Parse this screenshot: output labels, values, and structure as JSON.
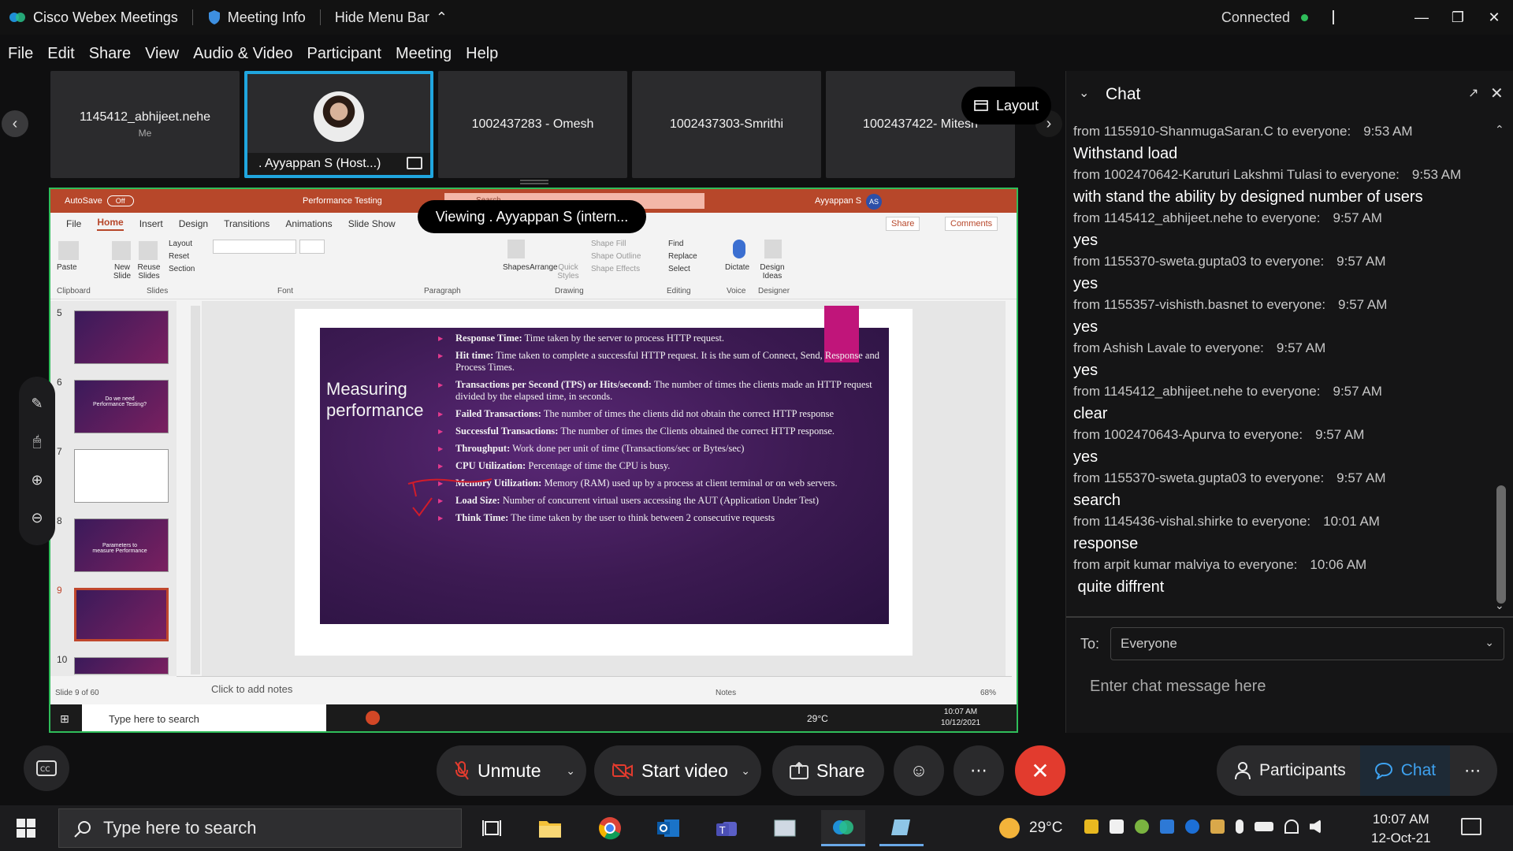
{
  "window": {
    "app_title": "Cisco Webex Meetings",
    "meeting_info_label": "Meeting Info",
    "hide_menu_label": "Hide Menu Bar",
    "status": "Connected",
    "status_color": "#2fbd5a"
  },
  "menu": [
    "File",
    "Edit",
    "Share",
    "View",
    "Audio & Video",
    "Participant",
    "Meeting",
    "Help"
  ],
  "participants": [
    {
      "name": "1145412_abhijeet.nehe",
      "sub": "Me"
    },
    {
      "name": ". Ayyappan S (Host...)",
      "sub": ""
    },
    {
      "name": "1002437283 - Omesh",
      "sub": ""
    },
    {
      "name": "1002437303-Smrithi",
      "sub": ""
    },
    {
      "name": "1002437422- Mitesh",
      "sub": ""
    }
  ],
  "layout_label": "Layout",
  "viewing_label": "Viewing . Ayyappan S (intern...",
  "ppt": {
    "autosave": "AutoSave",
    "autosave_state": "Off",
    "doc_name": "Performance Testing",
    "search": "Search",
    "user": "Ayyappan S",
    "user_initials": "AS",
    "tabs": [
      "File",
      "Home",
      "Insert",
      "Design",
      "Transitions",
      "Animations",
      "Slide Show"
    ],
    "share": "Share",
    "comments": "Comments",
    "groups": [
      "Clipboard",
      "Slides",
      "Font",
      "Paragraph",
      "Drawing",
      "Editing",
      "Voice",
      "Designer"
    ],
    "ribbon_buttons": {
      "paste": "Paste",
      "new_slide": "New Slide",
      "reuse_slides": "Reuse Slides",
      "layout": "Layout",
      "reset": "Reset",
      "section": "Section",
      "shapes": "Shapes",
      "arrange": "Arrange",
      "quick_styles": "Quick Styles",
      "shape_fill": "Shape Fill",
      "shape_outline": "Shape Outline",
      "shape_effects": "Shape Effects",
      "find": "Find",
      "replace": "Replace",
      "select": "Select",
      "dictate": "Dictate",
      "design_ideas": "Design Ideas"
    },
    "thumbnails": [
      {
        "num": "5",
        "text": ""
      },
      {
        "num": "6",
        "text": "Do we need Performance Testing?"
      },
      {
        "num": "7",
        "text": ""
      },
      {
        "num": "8",
        "text": "Parameters to measure Performance"
      },
      {
        "num": "9",
        "text": ""
      },
      {
        "num": "10",
        "text": ""
      }
    ],
    "slide_title": "Measuring performance",
    "bullets": [
      {
        "term": "Response Time:",
        "desc": " Time taken by the server to process HTTP request."
      },
      {
        "term": "Hit time:",
        "desc": " Time taken to complete a successful HTTP request. It is the sum of Connect, Send, Response and Process Times."
      },
      {
        "term": "Transactions per Second (TPS) or Hits/second:",
        "desc": " The number of times the clients made an HTTP request divided by the elapsed time, in seconds."
      },
      {
        "term": "Failed Transactions:",
        "desc": " The number of times the clients did not obtain the correct HTTP response"
      },
      {
        "term": "Successful Transactions:",
        "desc": " The number of times the Clients obtained the correct HTTP response."
      },
      {
        "term": "Throughput:",
        "desc": " Work done per unit of time (Transactions/sec or Bytes/sec)"
      },
      {
        "term": "CPU Utilization:",
        "desc": " Percentage of time the CPU is busy."
      },
      {
        "term": "Memory Utilization:",
        "desc": " Memory (RAM) used up by a process at client terminal or on web servers."
      },
      {
        "term": "Load Size:",
        "desc": " Number of concurrent virtual users accessing the AUT (Application Under Test)"
      },
      {
        "term": "Think Time:",
        "desc": " The time taken by the user to think between 2 consecutive requests"
      }
    ],
    "notes_placeholder": "Click to add notes",
    "slide_count": "Slide 9 of 60",
    "notes_label": "Notes",
    "zoom": "68%",
    "taskbar_search": "Type here to search",
    "temp": "29°C",
    "clock_time": "10:07 AM",
    "clock_date": "10/12/2021"
  },
  "chat": {
    "title": "Chat",
    "messages": [
      {
        "meta": "from 1155910-ShanmugaSaran.C to everyone:",
        "time": "9:53 AM",
        "text": "Withstand load"
      },
      {
        "meta": "from 1002470642-Karuturi Lakshmi Tulasi to everyone:",
        "time": "9:53 AM",
        "text": "with stand the ability by designed number of users"
      },
      {
        "meta": "from 1145412_abhijeet.nehe to everyone:",
        "time": "9:57 AM",
        "text": "yes"
      },
      {
        "meta": "from 1155370-sweta.gupta03 to everyone:",
        "time": "9:57 AM",
        "text": "yes"
      },
      {
        "meta": "from 1155357-vishisth.basnet to everyone:",
        "time": "9:57 AM",
        "text": "yes"
      },
      {
        "meta": "from Ashish Lavale to everyone:",
        "time": "9:57 AM",
        "text": "yes"
      },
      {
        "meta": "from 1145412_abhijeet.nehe to everyone:",
        "time": "9:57 AM",
        "text": "clear"
      },
      {
        "meta": "from 1002470643-Apurva to everyone:",
        "time": "9:57 AM",
        "text": "yes"
      },
      {
        "meta": "from 1155370-sweta.gupta03 to everyone:",
        "time": "9:57 AM",
        "text": "search"
      },
      {
        "meta": "from 1145436-vishal.shirke to everyone:",
        "time": "10:01 AM",
        "text": "response"
      },
      {
        "meta": "from arpit kumar malviya to everyone:",
        "time": "10:06 AM",
        "text": " quite diffrent"
      }
    ],
    "to_label": "To:",
    "to_value": "Everyone",
    "input_placeholder": "Enter chat message here"
  },
  "controls": {
    "unmute": "Unmute",
    "start_video": "Start video",
    "share": "Share",
    "participants": "Participants",
    "chat": "Chat",
    "end_color": "#e23b2e"
  },
  "taskbar": {
    "search_placeholder": "Type here to search",
    "temp": "29°C",
    "time": "10:07 AM",
    "date": "12-Oct-21"
  }
}
